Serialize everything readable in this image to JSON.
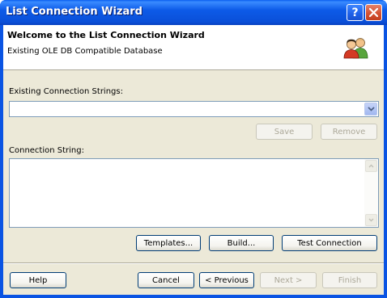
{
  "window": {
    "title": "List Connection Wizard",
    "help_button_glyph": "?",
    "close_button_glyph": "✕"
  },
  "header": {
    "title": "Welcome to the List Connection Wizard",
    "subtitle": "Existing OLE DB Compatible Database",
    "icon": "users-icon"
  },
  "existing": {
    "label": "Existing Connection Strings:",
    "value": "",
    "save_label": "Save",
    "remove_label": "Remove"
  },
  "connection": {
    "label": "Connection String:",
    "value": "",
    "templates_label": "Templates...",
    "build_label": "Build...",
    "test_label": "Test Connection"
  },
  "footer": {
    "help_label": "Help",
    "cancel_label": "Cancel",
    "previous_label": "< Previous",
    "next_label": "Next >",
    "finish_label": "Finish"
  },
  "colors": {
    "titlebar": "#0a54e3",
    "dialog_bg": "#ece9d8",
    "button_border": "#003c74",
    "disabled_text": "#aca899"
  }
}
